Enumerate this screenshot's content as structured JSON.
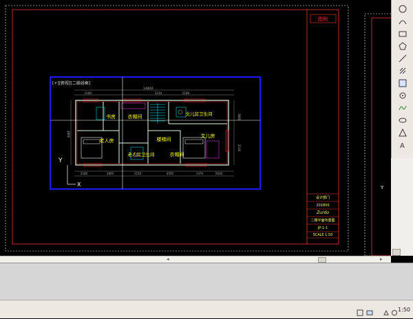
{
  "colors": {
    "frame": "#ff3030",
    "viewport": "#1a1aff",
    "wall": "#e0ffe0",
    "label": "#ffff00",
    "dim": "#b0b0b0",
    "crosshair": "#ffffff"
  },
  "sheet": {
    "tab_label": "图例",
    "viewport_title": "[+][俯视][二维线框]",
    "rooms": {
      "room1": "书房",
      "room2": "衣帽间",
      "room3": "文儿房卫生间",
      "room4": "老人房",
      "room5": "楼梯间",
      "room6": "文儿房",
      "room7": "老人房卫生间",
      "room8": "衣帽间"
    },
    "dims": {
      "top_total": "14800",
      "top_a": "2180",
      "top_b": "2120",
      "top_c": "2180",
      "bot_a": "2180",
      "bot_b": "2800",
      "bot_c": "2150",
      "bot_d": "4550",
      "bot_e": "1470",
      "bot_f": "2030",
      "right_a": "3880",
      "right_b": "2140",
      "left_a": "4800"
    },
    "title_block": {
      "company": "设计部门",
      "date": "201800",
      "signature": "Zurdo",
      "drawing_name": "二楼平面布置图",
      "sheet_no": "JP-1-1",
      "scale": "SCALE 1:50"
    },
    "ucs_y": "Y",
    "ucs_x": "X"
  },
  "statusbar": {
    "zoom": "1:50"
  },
  "tools": [
    "circle-tool-icon",
    "arc-tool-icon",
    "rectangle-tool-icon",
    "polygon-tool-icon",
    "line-tool-icon",
    "hatch-tool-icon",
    "text-tool-icon",
    "insert-block-icon",
    "point-tool-icon",
    "spline-tool-icon",
    "ellipse-tool-icon",
    "region-tool-icon",
    "multiline-text-icon",
    "table-tool-icon"
  ]
}
